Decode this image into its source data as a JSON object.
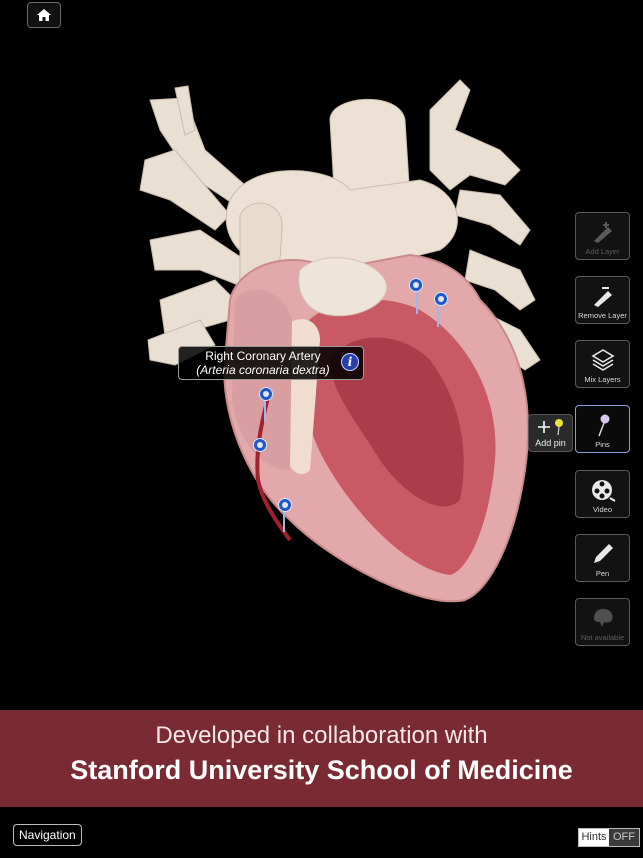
{
  "header": {
    "home_icon": "home-icon"
  },
  "callout": {
    "title": "Right Coronary Artery",
    "latin": "(Arteria coronaria dextra)",
    "info_icon": "info-icon"
  },
  "toolbar": {
    "tools": [
      {
        "label": "Add Layer",
        "icon": "add-layer-icon",
        "state": "disabled"
      },
      {
        "label": "Remove Layer",
        "icon": "remove-layer-icon",
        "state": "enabled"
      },
      {
        "label": "Mix Layers",
        "icon": "layers-icon",
        "state": "enabled"
      },
      {
        "label": "Pins",
        "icon": "pin-icon",
        "state": "active"
      },
      {
        "label": "Video",
        "icon": "video-reel-icon",
        "state": "enabled"
      },
      {
        "label": "Pen",
        "icon": "pen-icon",
        "state": "enabled"
      },
      {
        "label": "Not available",
        "icon": "brain-icon",
        "state": "disabled"
      }
    ],
    "add_pin_label": "Add pin"
  },
  "banner": {
    "line1": "Developed in collaboration with",
    "line2": "Stanford University School of Medicine"
  },
  "footer": {
    "navigation_label": "Navigation",
    "hints_label": "Hints",
    "hints_state": "OFF"
  },
  "colors": {
    "banner": "#7a2a33",
    "pin": "#1f57c4",
    "heart_tissue": "#e8b6b4",
    "vessels": "#eadfd3"
  }
}
